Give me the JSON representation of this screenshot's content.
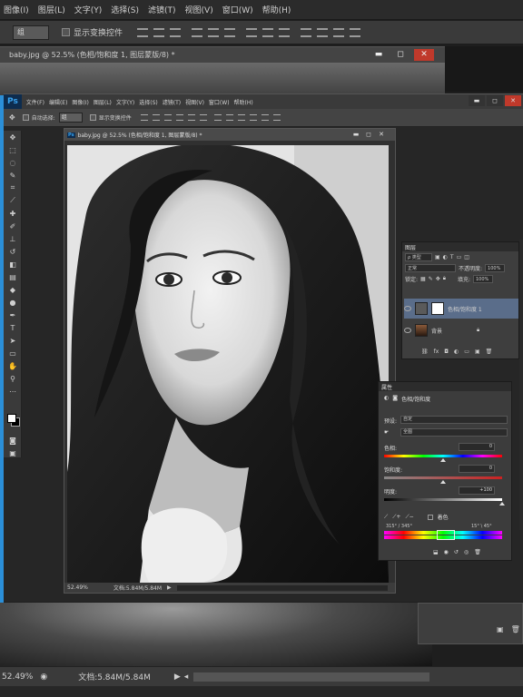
{
  "outer": {
    "menu": [
      "图像(I)",
      "图层(L)",
      "文字(Y)",
      "选择(S)",
      "滤镜(T)",
      "视图(V)",
      "窗口(W)",
      "帮助(H)"
    ],
    "options": {
      "select_value": "组",
      "checkbox_label": "显示变换控件"
    },
    "doc_title": "baby.jpg @ 52.5% (色相/饱和度 1, 图层蒙版/8) *",
    "status": {
      "zoom": "52.49%",
      "doc_size": "文档:5.84M/5.84M"
    }
  },
  "inner": {
    "logo": "Ps",
    "menu": [
      "文件(F)",
      "编辑(E)",
      "图像(I)",
      "图层(L)",
      "文字(Y)",
      "选择(S)",
      "滤镜(T)",
      "视图(V)",
      "窗口(W)",
      "帮助(H)"
    ],
    "options": {
      "auto_select_label": "自动选择:",
      "select_value": "组",
      "checkbox_label": "显示变换控件"
    },
    "doc_title": "baby.jpg @ 52.5% (色相/饱和度 1, 图层蒙版/8) *",
    "status": {
      "zoom": "52.49%",
      "doc_size": "文档:5.84M/5.84M"
    }
  },
  "layers_panel": {
    "title": "图层",
    "kind_filter": "ρ 类型",
    "blend_mode": "正常",
    "opacity_label": "不透明度:",
    "opacity_value": "100%",
    "lock_label": "锁定:",
    "fill_label": "填充:",
    "fill_value": "100%",
    "layers": [
      {
        "name": "色相/饱和度 1",
        "selected": true
      },
      {
        "name": "背景",
        "selected": false
      }
    ]
  },
  "properties_panel": {
    "title": "属性",
    "subtitle": "色相/饱和度",
    "preset_label": "预设:",
    "preset_value": "自定",
    "channel_value": "全图",
    "hue_label": "色相:",
    "hue_value": "0",
    "saturation_label": "饱和度:",
    "saturation_value": "0",
    "lightness_label": "明度:",
    "lightness_value": "+100",
    "colorize_label": "着色",
    "range_left": "315° / 345°",
    "range_right": "15° \\ 45°"
  }
}
